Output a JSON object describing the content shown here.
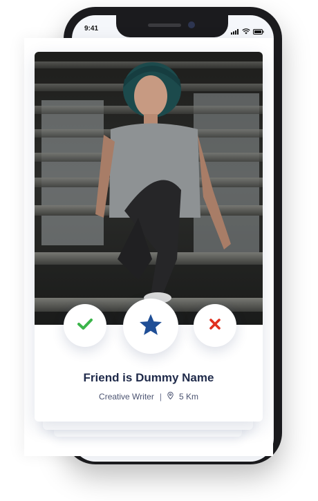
{
  "status_bar": {
    "time": "9:41"
  },
  "profile": {
    "name": "Friend is Dummy Name",
    "occupation": "Creative Writer",
    "separator": "|",
    "distance": "5 Km"
  },
  "actions": {
    "like_icon": "check-icon",
    "favorite_icon": "star-icon",
    "dislike_icon": "close-icon"
  },
  "colors": {
    "like": "#3bb54a",
    "favorite": "#1f4e96",
    "dislike": "#e0301e",
    "title": "#1f2a4a"
  }
}
